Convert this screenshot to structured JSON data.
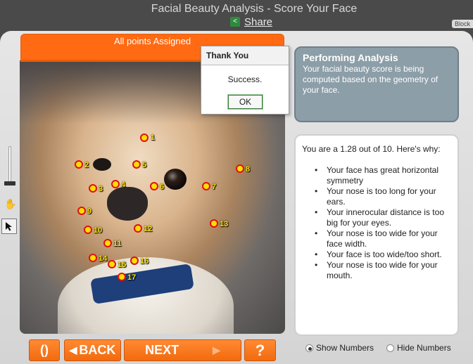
{
  "header": {
    "title": "Facial Beauty Analysis - Score Your Face",
    "share_label": "Share",
    "block_label": "Block"
  },
  "status": {
    "text": "All points Assigned",
    "color": "#ff6a12"
  },
  "dialog": {
    "title": "Thank You",
    "message": "Success.",
    "ok_label": "OK"
  },
  "analysis": {
    "title": "Performing Analysis",
    "text": "Your facial beauty score is being computed based on the geometry of your face."
  },
  "result": {
    "intro": "You are a 1.28 out of 10.  Here's why:",
    "reasons": [
      "Your face has great horizontal symmetry",
      "Your nose is too long for your ears.",
      "Your innerocular distance is too big for your eyes.",
      "Your nose is too wide for your face width.",
      "Your face is too wide/too short.",
      "Your nose is too wide for your mouth."
    ]
  },
  "landmarks": [
    "1",
    "2",
    "3",
    "4",
    "5",
    "6",
    "7",
    "8",
    "9",
    "10",
    "11",
    "12",
    "13",
    "14",
    "15",
    "16",
    "17"
  ],
  "controls": {
    "refresh_label": "()",
    "back_label": "BACK",
    "next_label": "NEXT",
    "help_label": "?",
    "show_numbers": "Show Numbers",
    "hide_numbers": "Hide Numbers",
    "numbers_mode": "show"
  },
  "icons": {
    "share": "share-icon",
    "hand": "hand-tool-icon",
    "pointer": "arrow-pointer-icon",
    "back": "triangle-left-icon",
    "next": "triangle-right-icon"
  }
}
